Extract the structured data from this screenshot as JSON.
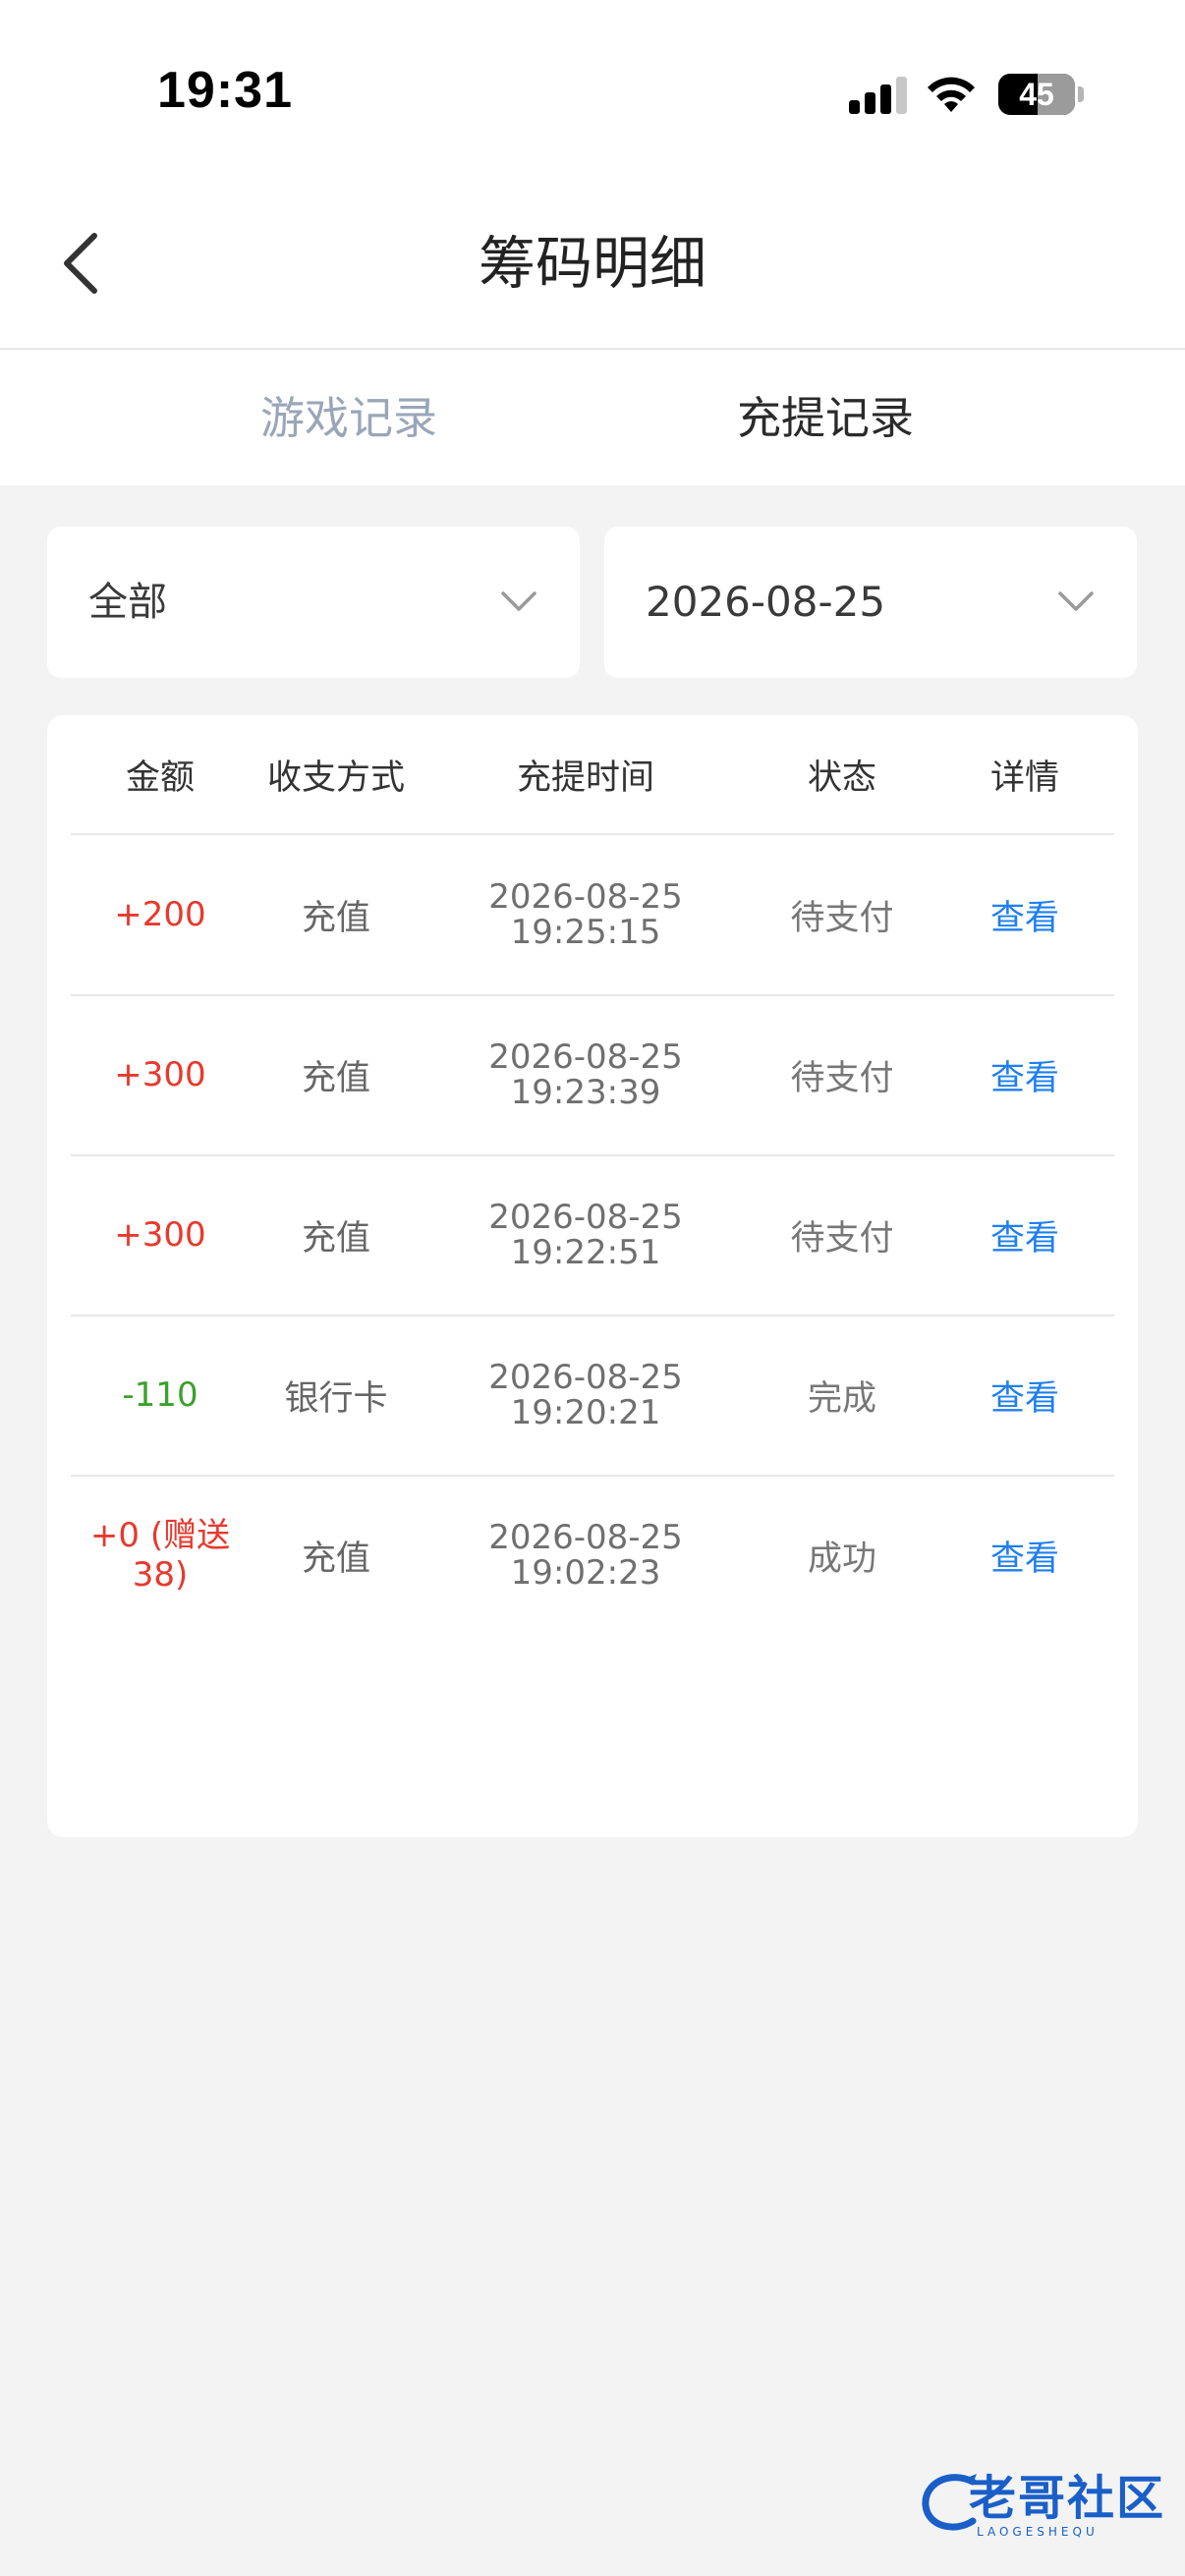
{
  "status_bar": {
    "time": "19:31",
    "battery": "45"
  },
  "nav": {
    "title": "筹码明细"
  },
  "tabs": [
    {
      "label": "游戏记录",
      "active": false
    },
    {
      "label": "充提记录",
      "active": true
    }
  ],
  "filters": {
    "type": "全部",
    "date": "2026-08-25"
  },
  "table": {
    "headers": [
      "金额",
      "收支方式",
      "充提时间",
      "状态",
      "详情"
    ],
    "rows": [
      {
        "amount": "+200",
        "method": "充值",
        "date": "2026-08-25",
        "time": "19:25:15",
        "status": "待支付",
        "detail": "查看"
      },
      {
        "amount": "+300",
        "method": "充值",
        "date": "2026-08-25",
        "time": "19:23:39",
        "status": "待支付",
        "detail": "查看"
      },
      {
        "amount": "+300",
        "method": "充值",
        "date": "2026-08-25",
        "time": "19:22:51",
        "status": "待支付",
        "detail": "查看"
      },
      {
        "amount": "-110",
        "method": "银行卡",
        "date": "2026-08-25",
        "time": "19:20:21",
        "status": "完成",
        "detail": "查看"
      },
      {
        "amount_line1": "+0 (赠送",
        "amount_line2": "38)",
        "method": "充值",
        "date": "2026-08-25",
        "time": "19:02:23",
        "status": "成功",
        "detail": "查看"
      }
    ]
  },
  "colors": {
    "positive": "#e8392c",
    "negative": "#3aa12a",
    "link": "#1f7ff0",
    "tab_inactive": "#9aa6b8"
  },
  "watermark": {
    "text": "老哥社区",
    "sub": "LAOGESHEQU"
  }
}
